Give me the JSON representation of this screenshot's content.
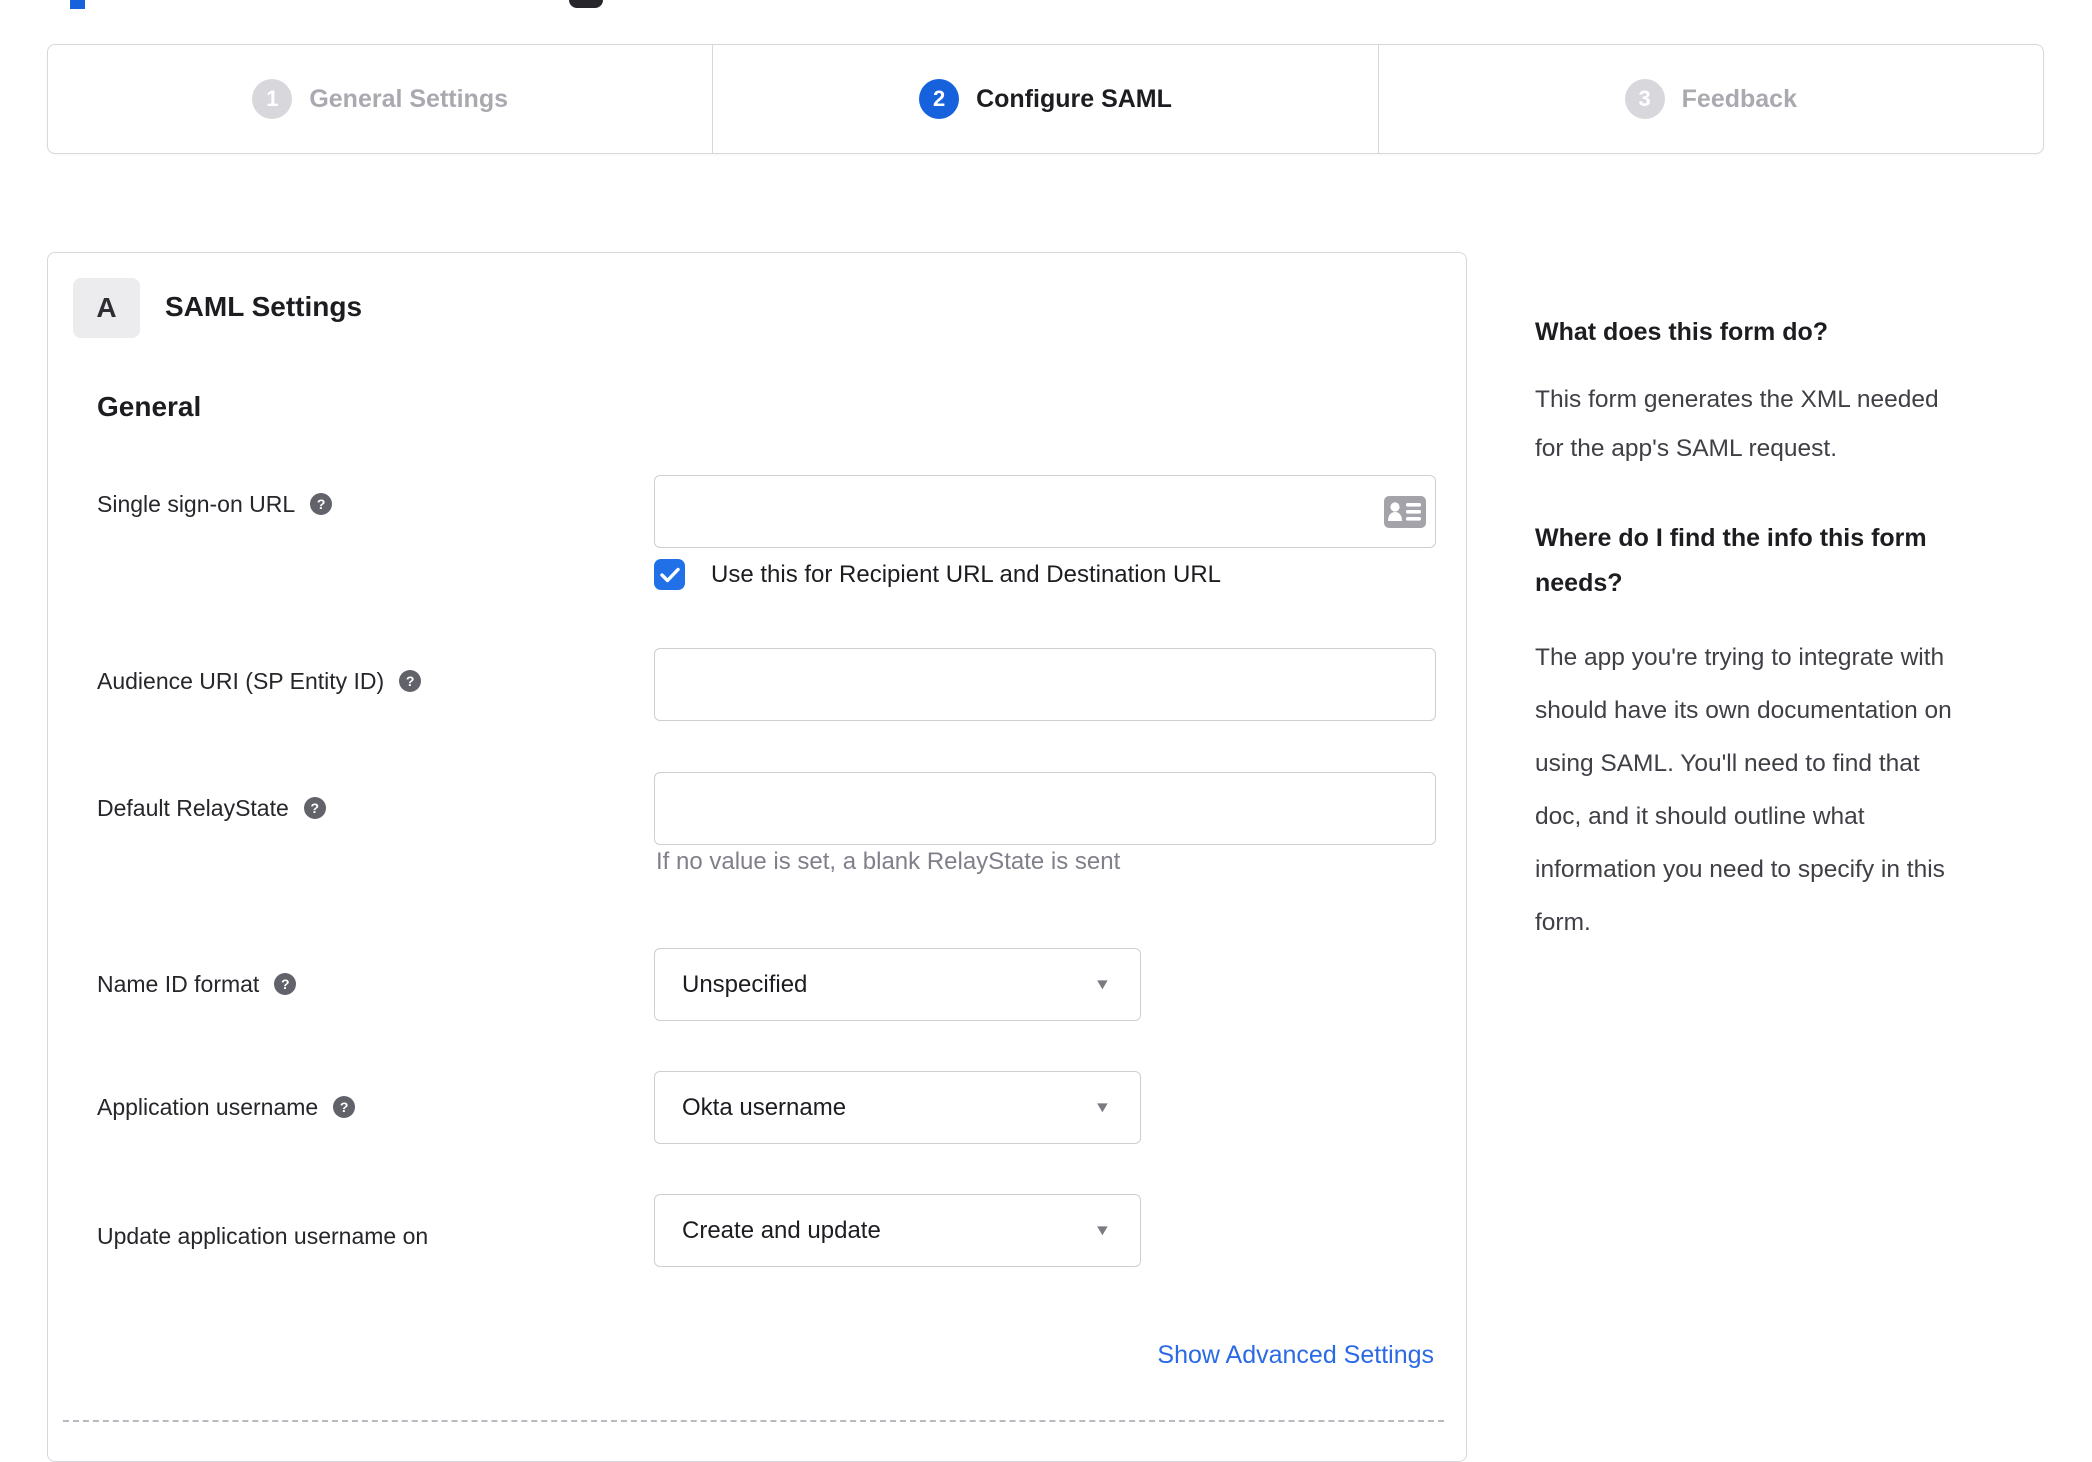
{
  "colors": {
    "accent_blue": "#1662dd",
    "checkbox_blue": "#2270e8",
    "link_blue": "#2a6ae4",
    "inactive_gray": "#a9a9b0",
    "border_gray": "#d8d8dc"
  },
  "stepper": {
    "steps": [
      {
        "number": "1",
        "label": "General Settings",
        "state": "inactive"
      },
      {
        "number": "2",
        "label": "Configure SAML",
        "state": "active"
      },
      {
        "number": "3",
        "label": "Feedback",
        "state": "inactive"
      }
    ]
  },
  "form": {
    "badge": "A",
    "title": "SAML Settings",
    "section": "General",
    "fields": {
      "sso": {
        "label": "Single sign-on URL",
        "value": ""
      },
      "sso_checkbox": {
        "label": "Use this for Recipient URL and Destination URL",
        "checked": true
      },
      "audience": {
        "label": "Audience URI (SP Entity ID)",
        "value": ""
      },
      "relay_state": {
        "label": "Default RelayState",
        "value": "",
        "hint": "If no value is set, a blank RelayState is sent"
      },
      "name_id_format": {
        "label": "Name ID format",
        "value": "Unspecified"
      },
      "app_username": {
        "label": "Application username",
        "value": "Okta username"
      },
      "update_username": {
        "label": "Update application username on",
        "value": "Create and update"
      }
    },
    "advanced_link": "Show Advanced Settings"
  },
  "help_panel": {
    "q1": "What does this form do?",
    "a1": "This form generates the XML needed for the app's SAML request.",
    "a1_lines": [
      "This form generates the XML needed",
      "for the app's SAML request."
    ],
    "q2": "Where do I find the info this form needs?",
    "q2_lines": [
      "Where do I find the info this form",
      "needs?"
    ],
    "a2": "The app you're trying to integrate with should have its own documentation on using SAML. You'll need to find that doc, and it should outline what information you need to specify in this form.",
    "a2_lines": [
      "The app you're trying to integrate with",
      "should have its own documentation on",
      "using SAML. You'll need to find that",
      "doc, and it should outline what",
      "information you need to specify in this",
      "form."
    ]
  },
  "glyphs": {
    "help": "?",
    "caret": "▼"
  }
}
